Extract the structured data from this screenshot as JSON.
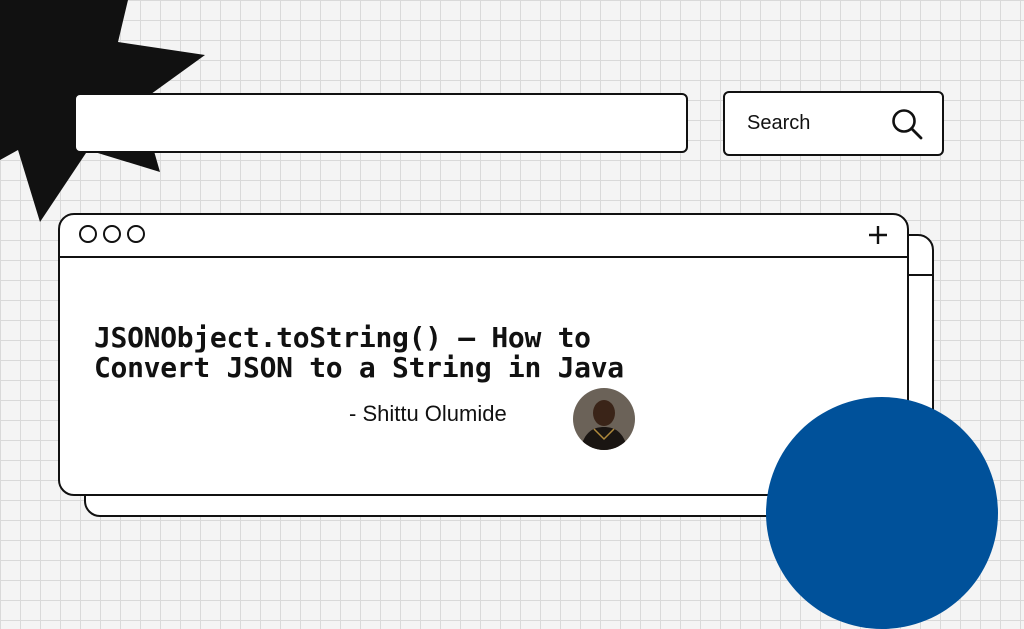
{
  "search": {
    "label": "Search"
  },
  "article": {
    "title_line1": "JSONObject.toString() – How to",
    "title_line2": "Convert JSON to a String in Java",
    "author": "- Shittu Olumide"
  },
  "colors": {
    "accent_blue": "#00519a",
    "ink": "#111111",
    "grid": "#d9d9d9"
  },
  "icons": {
    "search": "search-icon",
    "plus": "plus-icon",
    "window_dots": "window-dots-icon",
    "decor": "starburst-icon"
  }
}
